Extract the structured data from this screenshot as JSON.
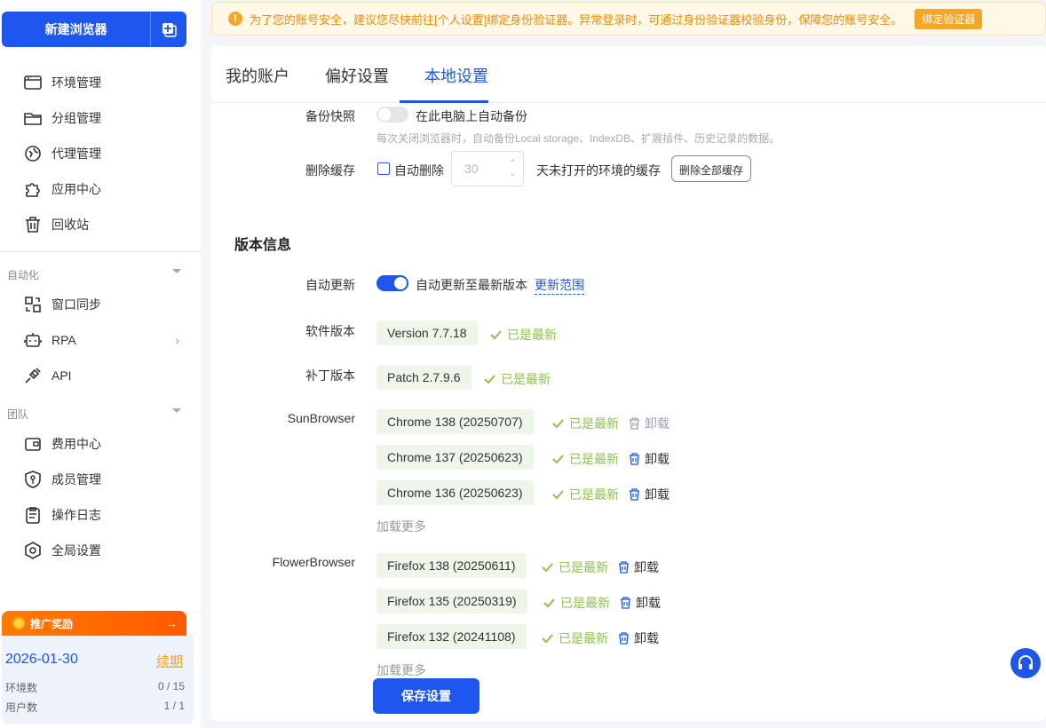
{
  "sidebar": {
    "new_browser": "新建浏览器",
    "items": [
      {
        "label": "环境管理",
        "icon": "browser-window-icon"
      },
      {
        "label": "分组管理",
        "icon": "folder-icon"
      },
      {
        "label": "代理管理",
        "icon": "proxy-icon"
      },
      {
        "label": "应用中心",
        "icon": "puzzle-icon"
      },
      {
        "label": "回收站",
        "icon": "trash-icon"
      }
    ],
    "automation": {
      "label": "自动化",
      "items": [
        {
          "label": "窗口同步",
          "icon": "window-sync-icon"
        },
        {
          "label": "RPA",
          "icon": "robot-icon"
        },
        {
          "label": "API",
          "icon": "plug-icon"
        }
      ]
    },
    "team": {
      "label": "团队",
      "items": [
        {
          "label": "费用中心",
          "icon": "wallet-icon"
        },
        {
          "label": "成员管理",
          "icon": "shield-key-icon"
        },
        {
          "label": "操作日志",
          "icon": "clipboard-icon"
        },
        {
          "label": "全局设置",
          "icon": "hex-gear-icon"
        }
      ]
    },
    "promo": "推广奖励",
    "plan": {
      "date": "2026-01-30",
      "renew": "续期",
      "env_label": "环境数",
      "env_value": "0 / 15",
      "user_label": "用户数",
      "user_value": "1 / 1"
    }
  },
  "banner": {
    "text": "为了您的账号安全，建议您尽快前往[个人设置]绑定身份验证器。异常登录时，可通过身份验证器校验身份，保障您的账号安全。",
    "button": "绑定验证器"
  },
  "tabs": [
    {
      "label": "我的账户",
      "active": false
    },
    {
      "label": "偏好设置",
      "active": false
    },
    {
      "label": "本地设置",
      "active": true
    }
  ],
  "backup": {
    "label": "备份快照",
    "toggle_text": "在此电脑上自动备份",
    "enabled": false,
    "hint": "每次关闭浏览器时，自动备份Local storage、IndexDB、扩展插件、历史记录的数据。"
  },
  "cache": {
    "label": "删除缓存",
    "checkbox": "自动删除",
    "days_placeholder": "30",
    "suffix": "天未打开的环境的缓存",
    "delete_all": "删除全部缓存"
  },
  "version": {
    "title": "版本信息",
    "auto_update": {
      "label": "自动更新",
      "text": "自动更新至最新版本",
      "link": "更新范围",
      "enabled": true
    },
    "software": {
      "label": "软件版本",
      "value": "Version 7.7.18",
      "status": "已是最新"
    },
    "patch": {
      "label": "补丁版本",
      "value": "Patch 2.7.9.6",
      "status": "已是最新"
    },
    "sunbrowser": {
      "label": "SunBrowser",
      "versions": [
        {
          "name": "Chrome 138 (20250707)",
          "status": "已是最新",
          "action": "卸载",
          "disabled": true
        },
        {
          "name": "Chrome 137 (20250623)",
          "status": "已是最新",
          "action": "卸载",
          "disabled": false
        },
        {
          "name": "Chrome 136 (20250623)",
          "status": "已是最新",
          "action": "卸载",
          "disabled": false
        }
      ],
      "more": "加载更多"
    },
    "flowerbrowser": {
      "label": "FlowerBrowser",
      "versions": [
        {
          "name": "Firefox 138 (20250611)",
          "status": "已是最新",
          "action": "卸载",
          "disabled": false
        },
        {
          "name": "Firefox 135 (20250319)",
          "status": "已是最新",
          "action": "卸载",
          "disabled": false
        },
        {
          "name": "Firefox 132 (20241108)",
          "status": "已是最新",
          "action": "卸载",
          "disabled": false
        }
      ],
      "more": "加载更多"
    }
  },
  "save": "保存设置",
  "colors": {
    "primary": "#1e56f0",
    "success": "#8bc34a",
    "warning": "#f5a623"
  }
}
